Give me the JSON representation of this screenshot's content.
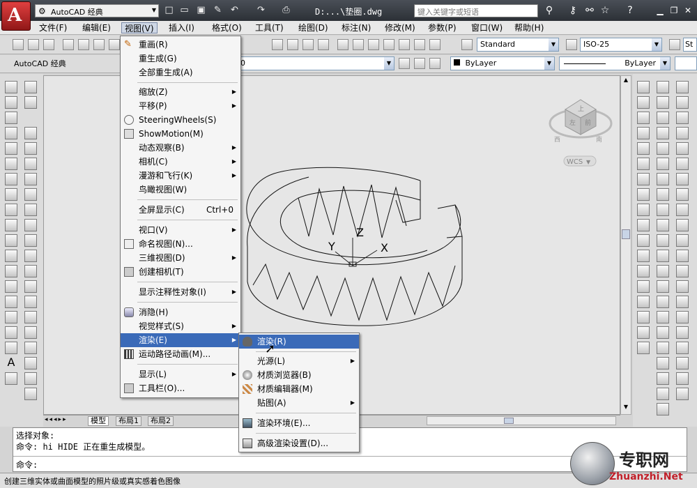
{
  "titlebar": {
    "workspace": "AutoCAD 经典",
    "doc_title": "D:...\\垫圈.dwg",
    "search_placeholder": "键入关键字或短语"
  },
  "menubar": [
    {
      "label": "文件(F)"
    },
    {
      "label": "编辑(E)"
    },
    {
      "label": "视图(V)"
    },
    {
      "label": "插入(I)"
    },
    {
      "label": "格式(O)"
    },
    {
      "label": "工具(T)"
    },
    {
      "label": "绘图(D)"
    },
    {
      "label": "标注(N)"
    },
    {
      "label": "修改(M)"
    },
    {
      "label": "参数(P)"
    },
    {
      "label": "窗口(W)"
    },
    {
      "label": "帮助(H)"
    }
  ],
  "toolbar": {
    "text_style": "Standard",
    "dim_style": "ISO-25",
    "dim_style_partial": "St",
    "workspace_label": "AutoCAD 经典",
    "layer": "0",
    "color": "ByLayer",
    "linetype": "ByLayer"
  },
  "view_menu": {
    "items": [
      {
        "label": "重画(R)",
        "sub": false
      },
      {
        "label": "重生成(G)",
        "sub": false
      },
      {
        "label": "全部重生成(A)",
        "sub": false
      },
      {
        "label": "缩放(Z)",
        "sub": true
      },
      {
        "label": "平移(P)",
        "sub": true
      },
      {
        "label": "SteeringWheels(S)",
        "sub": false
      },
      {
        "label": "ShowMotion(M)",
        "sub": false
      },
      {
        "label": "动态观察(B)",
        "sub": true
      },
      {
        "label": "相机(C)",
        "sub": true
      },
      {
        "label": "漫游和飞行(K)",
        "sub": true
      },
      {
        "label": "鸟瞰视图(W)",
        "sub": false
      },
      {
        "label": "全屏显示(C)",
        "shortcut": "Ctrl+0",
        "sub": false
      },
      {
        "label": "视口(V)",
        "sub": true
      },
      {
        "label": "命名视图(N)...",
        "sub": false
      },
      {
        "label": "三维视图(D)",
        "sub": true
      },
      {
        "label": "创建相机(T)",
        "sub": false
      },
      {
        "label": "显示注释性对象(I)",
        "sub": true
      },
      {
        "label": "消隐(H)",
        "sub": false
      },
      {
        "label": "视觉样式(S)",
        "sub": true
      },
      {
        "label": "渲染(E)",
        "sub": true
      },
      {
        "label": "运动路径动画(M)...",
        "sub": false
      },
      {
        "label": "显示(L)",
        "sub": true
      },
      {
        "label": "工具栏(O)...",
        "sub": false
      }
    ]
  },
  "render_menu": {
    "items": [
      {
        "label": "渲染(R)",
        "sub": false
      },
      {
        "label": "光源(L)",
        "sub": true
      },
      {
        "label": "材质浏览器(B)",
        "sub": false
      },
      {
        "label": "材质编辑器(M)",
        "sub": false
      },
      {
        "label": "贴图(A)",
        "sub": true
      },
      {
        "label": "渲染环境(E)...",
        "sub": false
      },
      {
        "label": "高级渲染设置(D)...",
        "sub": false
      }
    ]
  },
  "viewport": {
    "viewcube_label": "WCS",
    "viewcube_top": "上",
    "viewcube_front": "左",
    "viewcube_right": "前",
    "viewcube_compass_w": "西",
    "viewcube_compass_s": "南",
    "axis_x": "X",
    "axis_y": "Y",
    "axis_z": "Z"
  },
  "layout_tabs": [
    "模型",
    "布局1",
    "布局2"
  ],
  "command": {
    "line1": "选择对象:",
    "line2": "命令: hi HIDE 正在重生成模型。",
    "prompt": "命令:"
  },
  "status": "创建三维实体或曲面模型的照片级或真实感着色图像",
  "watermark": {
    "brand": "专职网",
    "url": "Zhuanzhi.Net"
  }
}
